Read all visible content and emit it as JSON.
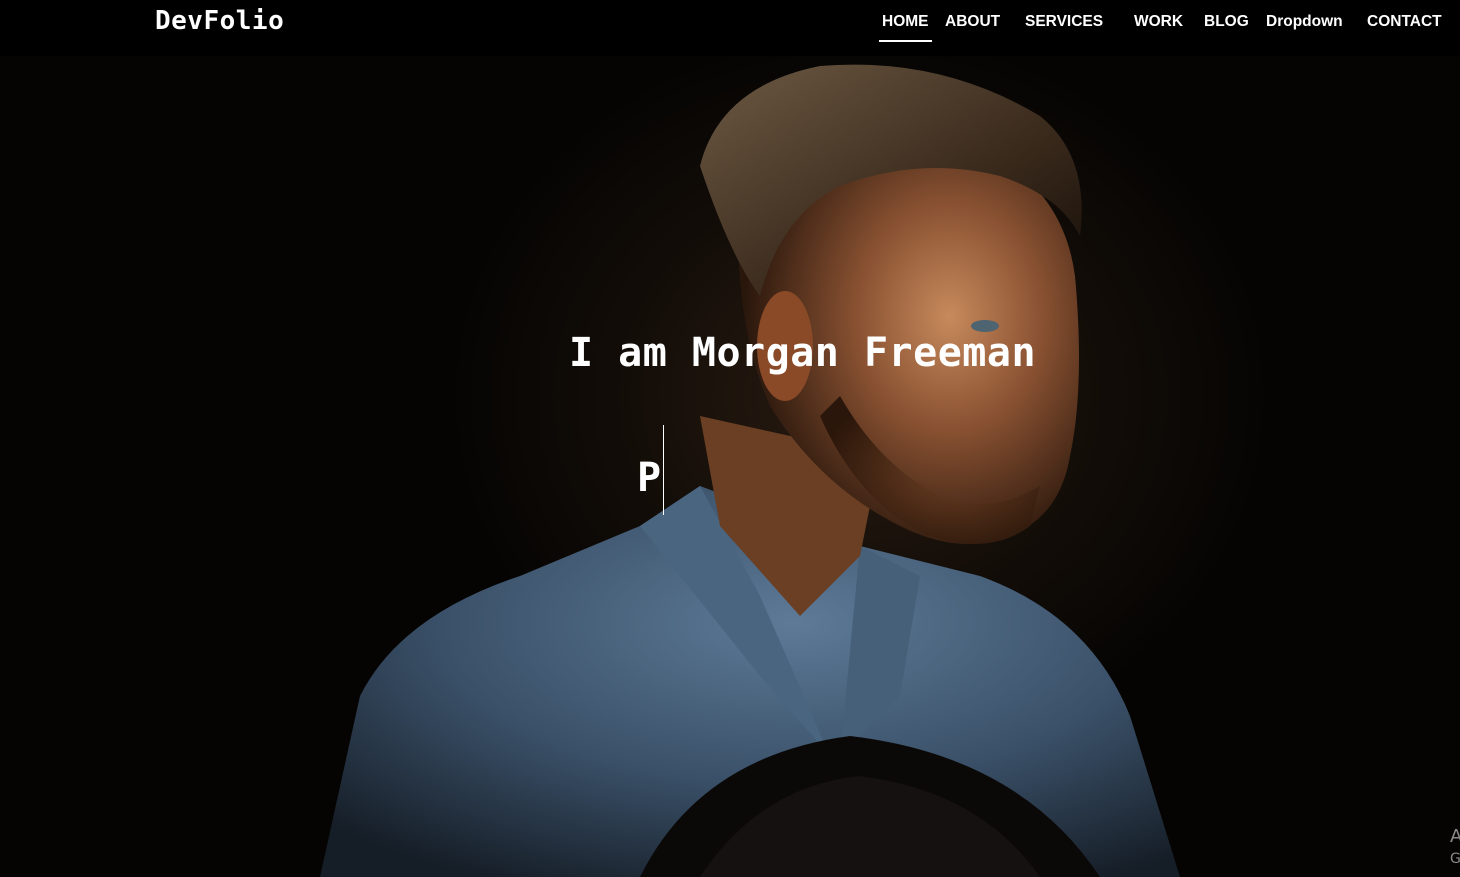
{
  "brand": "DevFolio",
  "nav": {
    "home": "HOME",
    "about": "ABOUT",
    "services": "SERVICES",
    "work": "WORK",
    "blog": "BLOG",
    "dropdown": "Dropdown",
    "contact": "CONTACT",
    "active": "HOME"
  },
  "hero": {
    "title": "I am Morgan Freeman",
    "typed_text": "P",
    "background": "portrait-photo"
  },
  "watermark": {
    "line1": "A",
    "line2": "G"
  },
  "colors": {
    "nav_bg": "#000000",
    "text": "#ffffff",
    "hero_bg": "#050403",
    "shirt": "#4f6a85",
    "skin": "#b7794f"
  }
}
